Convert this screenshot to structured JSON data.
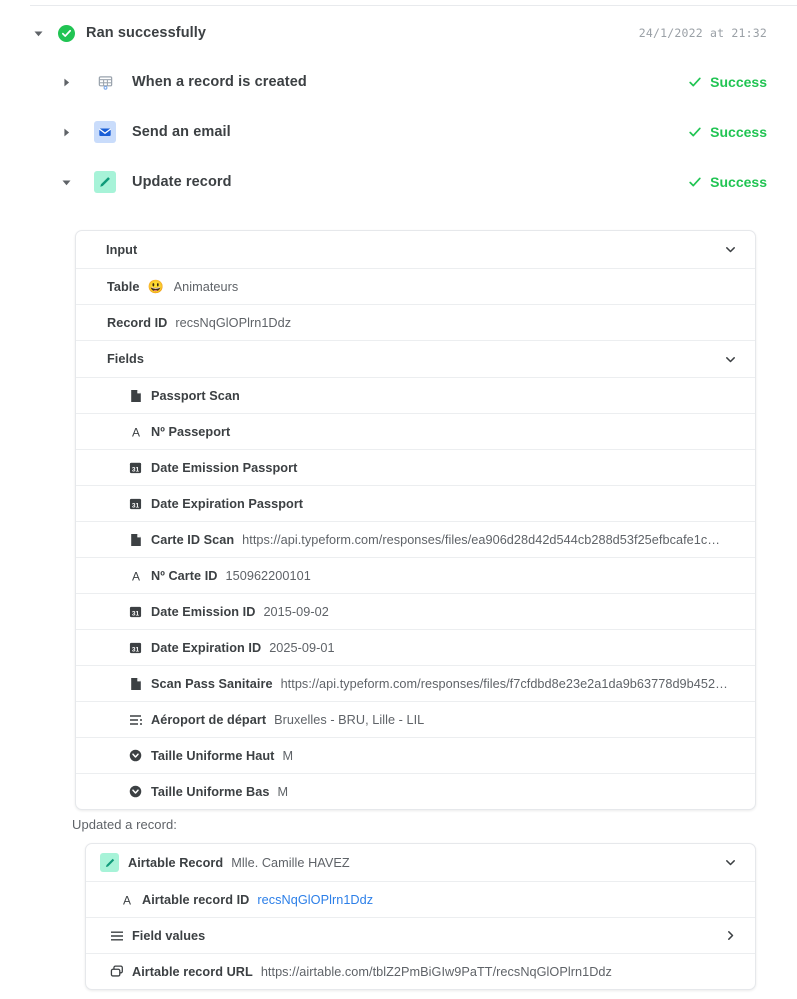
{
  "run": {
    "title": "Ran successfully",
    "timestamp": "24/1/2022 at 21:32",
    "status_color": "#21c453"
  },
  "steps": [
    {
      "label": "When a record is created",
      "status": "Success",
      "icon": "grid-table-icon",
      "expanded": false
    },
    {
      "label": "Send an email",
      "status": "Success",
      "icon": "envelope-icon",
      "expanded": false
    },
    {
      "label": "Update record",
      "status": "Success",
      "icon": "pencil-icon",
      "expanded": true
    }
  ],
  "input_card": {
    "header": "Input",
    "table": {
      "key": "Table",
      "emoji": "😃",
      "value": "Animateurs"
    },
    "record_id": {
      "key": "Record ID",
      "value": "recsNqGlOPlrn1Ddz"
    },
    "fields_header": "Fields",
    "fields": [
      {
        "icon": "attachment-file-icon",
        "key": "Passport Scan",
        "value": ""
      },
      {
        "icon": "text-a-icon",
        "key": "Nº Passeport",
        "value": ""
      },
      {
        "icon": "calendar-31-icon",
        "key": "Date Emission Passport",
        "value": ""
      },
      {
        "icon": "calendar-31-icon",
        "key": "Date Expiration Passport",
        "value": ""
      },
      {
        "icon": "attachment-file-icon",
        "key": "Carte ID Scan",
        "value": "https://api.typeform.com/responses/files/ea906d28d42d544cb288d53f25efbcafe1c…"
      },
      {
        "icon": "text-a-icon",
        "key": "Nº Carte ID",
        "value": "150962200101"
      },
      {
        "icon": "calendar-31-icon",
        "key": "Date Emission ID",
        "value": "2015-09-02"
      },
      {
        "icon": "calendar-31-icon",
        "key": "Date Expiration ID",
        "value": "2025-09-01"
      },
      {
        "icon": "attachment-file-icon",
        "key": "Scan Pass Sanitaire",
        "value": "https://api.typeform.com/responses/files/f7cfdbd8e23e2a1da9b63778d9b452…"
      },
      {
        "icon": "multiselect-list-icon",
        "key": "Aéroport de départ",
        "value": "Bruxelles - BRU, Lille - LIL"
      },
      {
        "icon": "single-select-icon",
        "key": "Taille Uniforme Haut",
        "value": "M"
      },
      {
        "icon": "single-select-icon",
        "key": "Taille Uniforme Bas",
        "value": "M"
      }
    ]
  },
  "output": {
    "section_label": "Updated a record:",
    "record_header": {
      "key": "Airtable Record",
      "value": "Mlle. Camille HAVEZ"
    },
    "rows": [
      {
        "icon": "text-a-icon",
        "key": "Airtable record ID",
        "value": "recsNqGlOPlrn1Ddz",
        "style": "link",
        "chevron": ""
      },
      {
        "icon": "list-lines-icon",
        "key": "Field values",
        "value": "",
        "style": "dark",
        "chevron": "right"
      },
      {
        "icon": "copy-stack-icon",
        "key": "Airtable record URL",
        "value": "https://airtable.com/tblZ2PmBiGIw9PaTT/recsNqGlOPlrn1Ddz",
        "style": "dark",
        "chevron": ""
      }
    ]
  }
}
